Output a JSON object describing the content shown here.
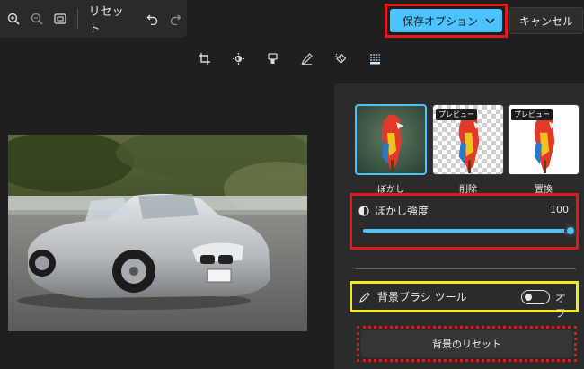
{
  "toolbar": {
    "zoom_in_icon": "zoom-in-icon",
    "zoom_out_icon": "zoom-out-icon",
    "fit_icon": "fit-to-window-icon",
    "reset_label": "リセット",
    "undo_icon": "undo-icon",
    "redo_icon": "redo-icon"
  },
  "header": {
    "save_label": "保存オプション",
    "cancel_label": "キャンセル"
  },
  "modes": [
    {
      "icon": "crop-icon"
    },
    {
      "icon": "brightness-icon"
    },
    {
      "icon": "filter-icon"
    },
    {
      "icon": "markup-pen-icon"
    },
    {
      "icon": "erase-icon"
    },
    {
      "icon": "background-icon"
    }
  ],
  "background_panel": {
    "options": [
      {
        "label": "ぼかし",
        "badge": ""
      },
      {
        "label": "削除",
        "badge": "プレビュー"
      },
      {
        "label": "置換",
        "badge": "プレビュー"
      }
    ],
    "blur": {
      "label": "ぼかし強度",
      "value": "100",
      "level_percent": 100
    },
    "brush": {
      "label": "背景ブラシ ツール",
      "toggle_state": "オフ"
    },
    "reset_label": "背景のリセット"
  },
  "colors": {
    "accent": "#4cc2ff",
    "highlight_red": "#e01a1a",
    "highlight_yellow": "#f0ea1e",
    "background": "#1f1f1f",
    "panel": "#2b2b2b"
  }
}
